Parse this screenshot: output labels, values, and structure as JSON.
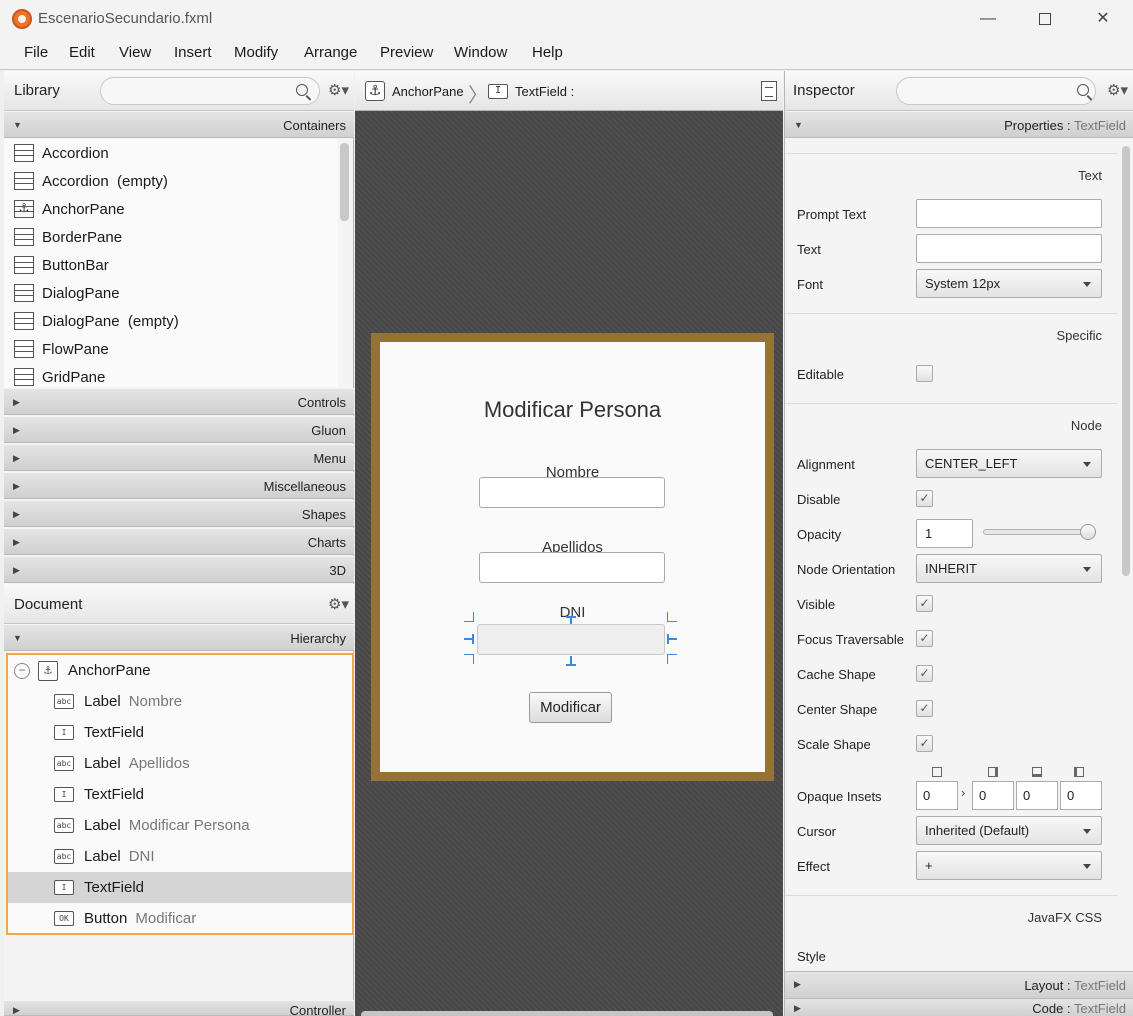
{
  "window": {
    "title": "EscenarioSecundario.fxml",
    "minimize_glyph": "—",
    "close_glyph": "✕"
  },
  "menu": [
    "File",
    "Edit",
    "View",
    "Insert",
    "Modify",
    "Arrange",
    "Preview",
    "Window",
    "Help"
  ],
  "library": {
    "title": "Library",
    "search_placeholder": "",
    "containers_label": "Containers",
    "items": [
      {
        "name": "Accordion",
        "note": ""
      },
      {
        "name": "Accordion",
        "note": "(empty)"
      },
      {
        "name": "AnchorPane",
        "note": ""
      },
      {
        "name": "BorderPane",
        "note": ""
      },
      {
        "name": "ButtonBar",
        "note": ""
      },
      {
        "name": "DialogPane",
        "note": ""
      },
      {
        "name": "DialogPane",
        "note": "(empty)"
      },
      {
        "name": "FlowPane",
        "note": ""
      },
      {
        "name": "GridPane",
        "note": ""
      }
    ],
    "sections": [
      "Controls",
      "Gluon",
      "Menu",
      "Miscellaneous",
      "Shapes",
      "Charts",
      "3D"
    ]
  },
  "document": {
    "title": "Document",
    "hierarchy_label": "Hierarchy",
    "root": "AnchorPane",
    "nodes": [
      {
        "icon": "abc",
        "type": "Label",
        "value": "Nombre"
      },
      {
        "icon": "I",
        "type": "TextField",
        "value": ""
      },
      {
        "icon": "abc",
        "type": "Label",
        "value": "Apellidos"
      },
      {
        "icon": "I",
        "type": "TextField",
        "value": ""
      },
      {
        "icon": "abc",
        "type": "Label",
        "value": "Modificar Persona"
      },
      {
        "icon": "abc",
        "type": "Label",
        "value": "DNI"
      },
      {
        "icon": "I",
        "type": "TextField",
        "value": ""
      },
      {
        "icon": "OK",
        "type": "Button",
        "value": "Modificar"
      }
    ],
    "controller_label": "Controller"
  },
  "breadcrumb": {
    "root": "AnchorPane",
    "current": "TextField :"
  },
  "stage": {
    "title": "Modificar Persona",
    "label_nombre": "Nombre",
    "label_apellidos": "Apellidos",
    "label_dni": "DNI",
    "button": "Modificar"
  },
  "inspector": {
    "title": "Inspector",
    "properties_label": "Properties",
    "properties_target": "TextField",
    "sections": {
      "text": "Text",
      "specific": "Specific",
      "node": "Node",
      "css": "JavaFX CSS"
    },
    "labels": {
      "prompt_text": "Prompt Text",
      "text": "Text",
      "font": "Font",
      "editable": "Editable",
      "alignment": "Alignment",
      "disable": "Disable",
      "opacity": "Opacity",
      "node_orientation": "Node Orientation",
      "visible": "Visible",
      "focus_traversable": "Focus Traversable",
      "cache_shape": "Cache Shape",
      "center_shape": "Center Shape",
      "scale_shape": "Scale Shape",
      "opaque_insets": "Opaque Insets",
      "cursor": "Cursor",
      "effect": "Effect",
      "style": "Style"
    },
    "values": {
      "prompt_text": "",
      "text": "",
      "font": "System 12px",
      "alignment": "CENTER_LEFT",
      "opacity": "1",
      "opacity_level": 1.0,
      "node_orientation": "INHERIT",
      "opaque_insets": [
        "0",
        "0",
        "0",
        "0"
      ],
      "cursor": "Inherited (Default)",
      "effect": "+"
    },
    "checks": {
      "editable": false,
      "disable": true,
      "visible": true,
      "focus_traversable": true,
      "cache_shape": true,
      "center_shape": true,
      "scale_shape": true
    },
    "layout_label": "Layout",
    "code_label": "Code",
    "bottom_target": "TextField"
  },
  "colors": {
    "stage_border": "#957236",
    "selection_outline": "#f0a84a",
    "guide_blue": "#3e88d6"
  }
}
